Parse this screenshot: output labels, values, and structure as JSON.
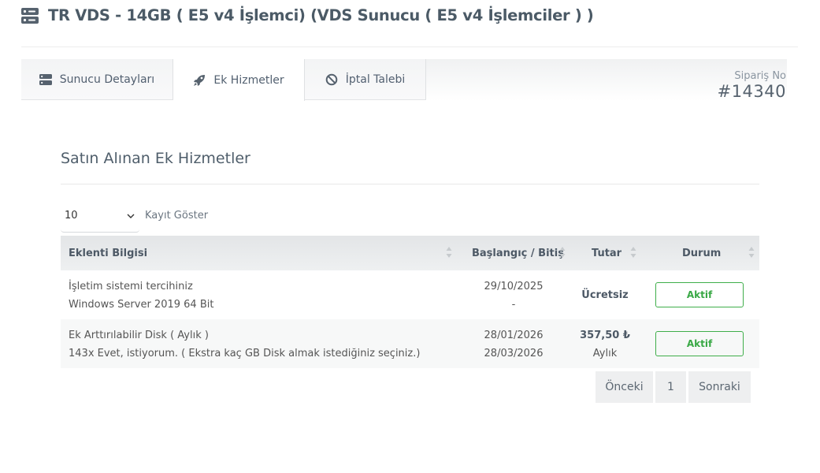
{
  "page": {
    "title": "TR VDS - 14GB ( E5 v4 İşlemci) (VDS Sunucu ( E5 v4 İşlemciler ) )"
  },
  "tabs": [
    {
      "label": "Sunucu Detayları",
      "icon": "server-icon"
    },
    {
      "label": "Ek Hizmetler",
      "icon": "rocket-icon",
      "active": true
    },
    {
      "label": "İptal Talebi",
      "icon": "ban-icon"
    }
  ],
  "order": {
    "label": "Sipariş No",
    "number": "#14340"
  },
  "section": {
    "title": "Satın Alınan Ek Hizmetler"
  },
  "length_control": {
    "selected": "10",
    "label": "Kayıt Göster"
  },
  "table": {
    "columns": [
      "Eklenti Bilgisi",
      "Başlangıç / Bitiş",
      "Tutar",
      "Durum"
    ],
    "rows": [
      {
        "name": "İşletim sistemi tercihiniz",
        "detail": "Windows Server 2019 64 Bit",
        "start": "29/10/2025",
        "end": "-",
        "amount": "Ücretsiz",
        "period": "",
        "status": "Aktif"
      },
      {
        "name": "Ek Arttırılabilir Disk ( Aylık )",
        "detail": "143x Evet, istiyorum. ( Ekstra kaç GB Disk almak istediğiniz seçiniz.)",
        "start": "28/01/2026",
        "end": "28/03/2026",
        "amount": "357,50 ₺",
        "period": "Aylık",
        "status": "Aktif"
      }
    ]
  },
  "pagination": {
    "prev": "Önceki",
    "current": "1",
    "next": "Sonraki"
  },
  "colors": {
    "accent_green": "#39a845",
    "title_text": "#4b5a66",
    "icon": "#56626e"
  }
}
